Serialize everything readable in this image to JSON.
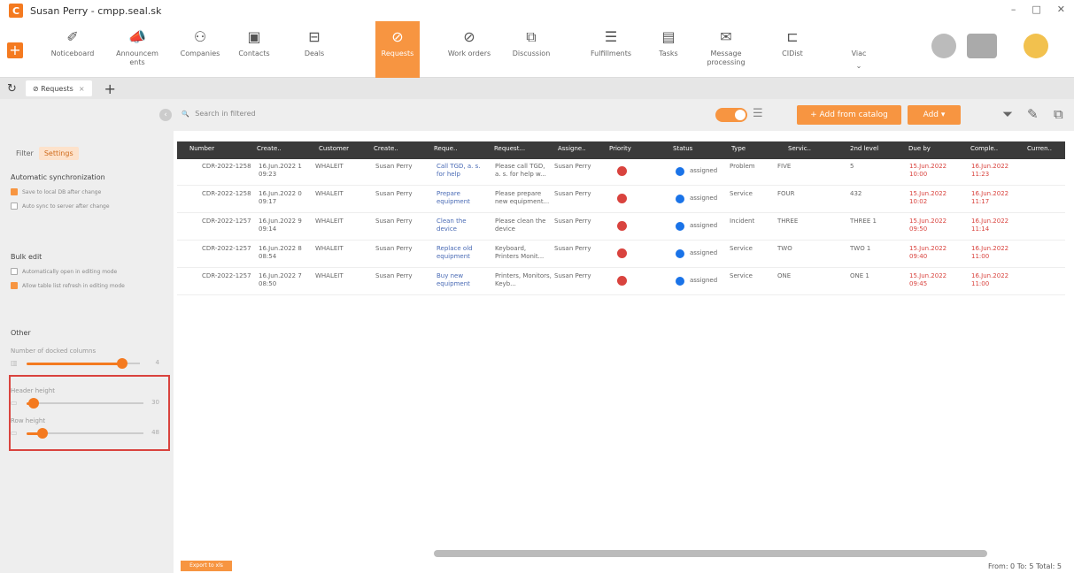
{
  "window": {
    "title": "Susan Perry - cmpp.seal.sk",
    "minimize": "–",
    "maximize": "□",
    "close": "✕"
  },
  "nav": {
    "items": [
      {
        "icon": "noticeboard-icon",
        "glyph": "✐",
        "label": "Noticeboard"
      },
      {
        "icon": "announcements-icon",
        "glyph": "📣",
        "label": "Announcem ents"
      },
      {
        "icon": "companies-icon",
        "glyph": "⚇",
        "label": "Companies"
      },
      {
        "icon": "contacts-icon",
        "glyph": "▣",
        "label": "Contacts"
      },
      {
        "icon": "deals-icon",
        "glyph": "⊟",
        "label": "Deals"
      },
      {
        "icon": "requests-icon",
        "glyph": "⊘",
        "label": "Requests"
      },
      {
        "icon": "work-orders-icon",
        "glyph": "⊘",
        "label": "Work orders"
      },
      {
        "icon": "discussion-icon",
        "glyph": "⧉",
        "label": "Discussion"
      },
      {
        "icon": "fulfillments-icon",
        "glyph": "☰",
        "label": "Fulfillments"
      },
      {
        "icon": "tasks-icon",
        "glyph": "▤",
        "label": "Tasks"
      },
      {
        "icon": "message-processing-icon",
        "glyph": "✉",
        "label": "Message processing"
      },
      {
        "icon": "cidlist-icon",
        "glyph": "⊏",
        "label": "CIDist"
      },
      {
        "icon": "more-icon",
        "glyph": "",
        "label": "Viac"
      }
    ],
    "more_caret": "⌄"
  },
  "tabs": {
    "refresh": "↻",
    "active_tab": "⊘ Requests",
    "close": "×",
    "add": "+"
  },
  "toolbar": {
    "search_placeholder": "Search in filtered",
    "search_icon": "🔍",
    "collapse": "‹",
    "list_icon": "☰",
    "add_from_catalog": "+  Add from catalog",
    "add": "Add ▾",
    "filter_icon": "⏷",
    "edit_icon": "✎",
    "copy_icon": "⧉"
  },
  "sidebar": {
    "tabs": [
      "Filter",
      "Settings"
    ],
    "auto_sync": {
      "title": "Automatic synchronization",
      "options": [
        {
          "label": "Save to local DB after change",
          "checked": true
        },
        {
          "label": "Auto sync to server after change",
          "checked": false
        }
      ]
    },
    "bulk_edit": {
      "title": "Bulk edit",
      "options": [
        {
          "label": "Automatically open in editing mode",
          "checked": false
        },
        {
          "label": "Allow table list refresh in editing mode",
          "checked": true
        }
      ]
    },
    "other": {
      "title": "Other",
      "docked_label": "Number of docked columns",
      "docked_value": "4",
      "header_label": "Header height",
      "header_value": "30",
      "row_label": "Row height",
      "row_value": "48"
    }
  },
  "grid": {
    "headers": [
      "Number",
      "Create..",
      "Customer",
      "Create..",
      "Reque..",
      "Request...",
      "Assigne..",
      "Priority",
      "Status",
      "Type",
      "Servic..",
      "2nd level",
      "Due by",
      "Comple..",
      "Curren.."
    ],
    "rows": [
      {
        "number": "CDR-2022-1258",
        "created": "16.Jun.2022 1 09:23",
        "customer": "WHALEIT",
        "creator": "Susan Perry",
        "request": "Call TGD, a. s. for help",
        "description": "Please call TGD, a. s. for help w...",
        "assignee": "Susan Perry",
        "status": "assigned",
        "type": "Problem",
        "service": "FIVE",
        "level2": "5",
        "due": "15.Jun.2022 10:00",
        "completed": "16.Jun.2022 11:23"
      },
      {
        "number": "CDR-2022-1258",
        "created": "16.Jun.2022 0 09:17",
        "customer": "WHALEIT",
        "creator": "Susan Perry",
        "request": "Prepare equipment",
        "description": "Please prepare new equipment...",
        "assignee": "Susan Perry",
        "status": "assigned",
        "type": "Service",
        "service": "FOUR",
        "level2": "432",
        "due": "15.Jun.2022 10:02",
        "completed": "16.Jun.2022 11:17"
      },
      {
        "number": "CDR-2022-1257",
        "created": "16.Jun.2022 9 09:14",
        "customer": "WHALEIT",
        "creator": "Susan Perry",
        "request": "Clean the device",
        "description": "Please clean the device",
        "assignee": "Susan Perry",
        "status": "assigned",
        "type": "Incident",
        "service": "THREE",
        "level2": "THREE 1",
        "due": "15.Jun.2022 09:50",
        "completed": "16.Jun.2022 11:14"
      },
      {
        "number": "CDR-2022-1257",
        "created": "16.Jun.2022 8 08:54",
        "customer": "WHALEIT",
        "creator": "Susan Perry",
        "request": "Replace old equipment",
        "description": "Keyboard, Printers Monit...",
        "assignee": "Susan Perry",
        "status": "assigned",
        "type": "Service",
        "service": "TWO",
        "level2": "TWO 1",
        "due": "15.Jun.2022 09:40",
        "completed": "16.Jun.2022 11:00"
      },
      {
        "number": "CDR-2022-1257",
        "created": "16.Jun.2022 7 08:50",
        "customer": "WHALEIT",
        "creator": "Susan Perry",
        "request": "Buy new equipment",
        "description": "Printers, Monitors, Keyb...",
        "assignee": "Susan Perry",
        "status": "assigned",
        "type": "Service",
        "service": "ONE",
        "level2": "ONE 1",
        "due": "15.Jun.2022 09:45",
        "completed": "16.Jun.2022 11:00"
      }
    ]
  },
  "footer": {
    "export": "Export to xls",
    "pager": "From: 0   To: 5   Total: 5"
  },
  "colors": {
    "accent": "#f79541",
    "header": "#3a3a3a",
    "priority": "#d9433e",
    "status": "#1a73e8"
  }
}
